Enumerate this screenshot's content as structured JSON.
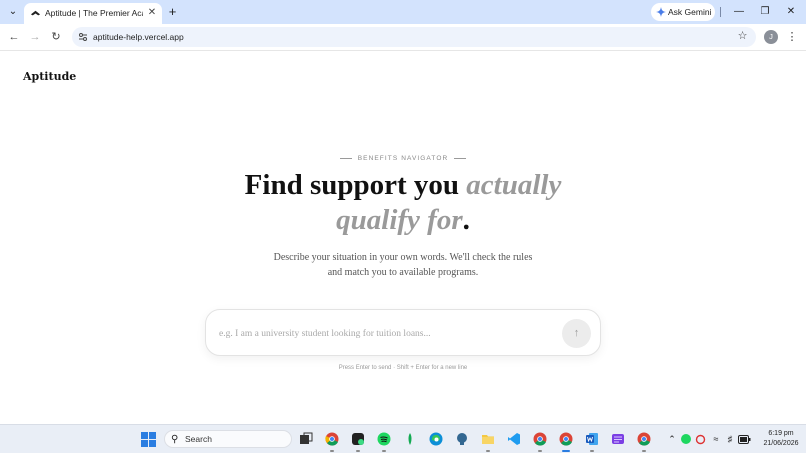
{
  "browser": {
    "tab_title": "Aptitude | The Premier Academic",
    "ask_gemini": "Ask Gemini",
    "url": "aptitude-help.vercel.app",
    "profile_initial": "J"
  },
  "page": {
    "brand": "Aptitude",
    "eyebrow": "BENEFITS NAVIGATOR",
    "headline_plain": "Find support you ",
    "headline_em_1": "actually",
    "headline_em_2": "qualify for",
    "headline_end": ".",
    "subtitle": "Describe your situation in your own words. We'll check the rules and match you to available programs.",
    "prompt_placeholder": "e.g. I am a university student looking for tuition loans...",
    "hint": "Press Enter to send · Shift + Enter for a new line"
  },
  "taskbar": {
    "search_label": "Search",
    "time": "6:19 pm",
    "date": "21/06/2026"
  },
  "colors": {
    "tabstrip": "#d3e3fd",
    "omnibox": "#eef3fc",
    "muted_italic": "#9a9a9a",
    "send_button": "#ececec",
    "taskbar": "#e9eef6"
  }
}
